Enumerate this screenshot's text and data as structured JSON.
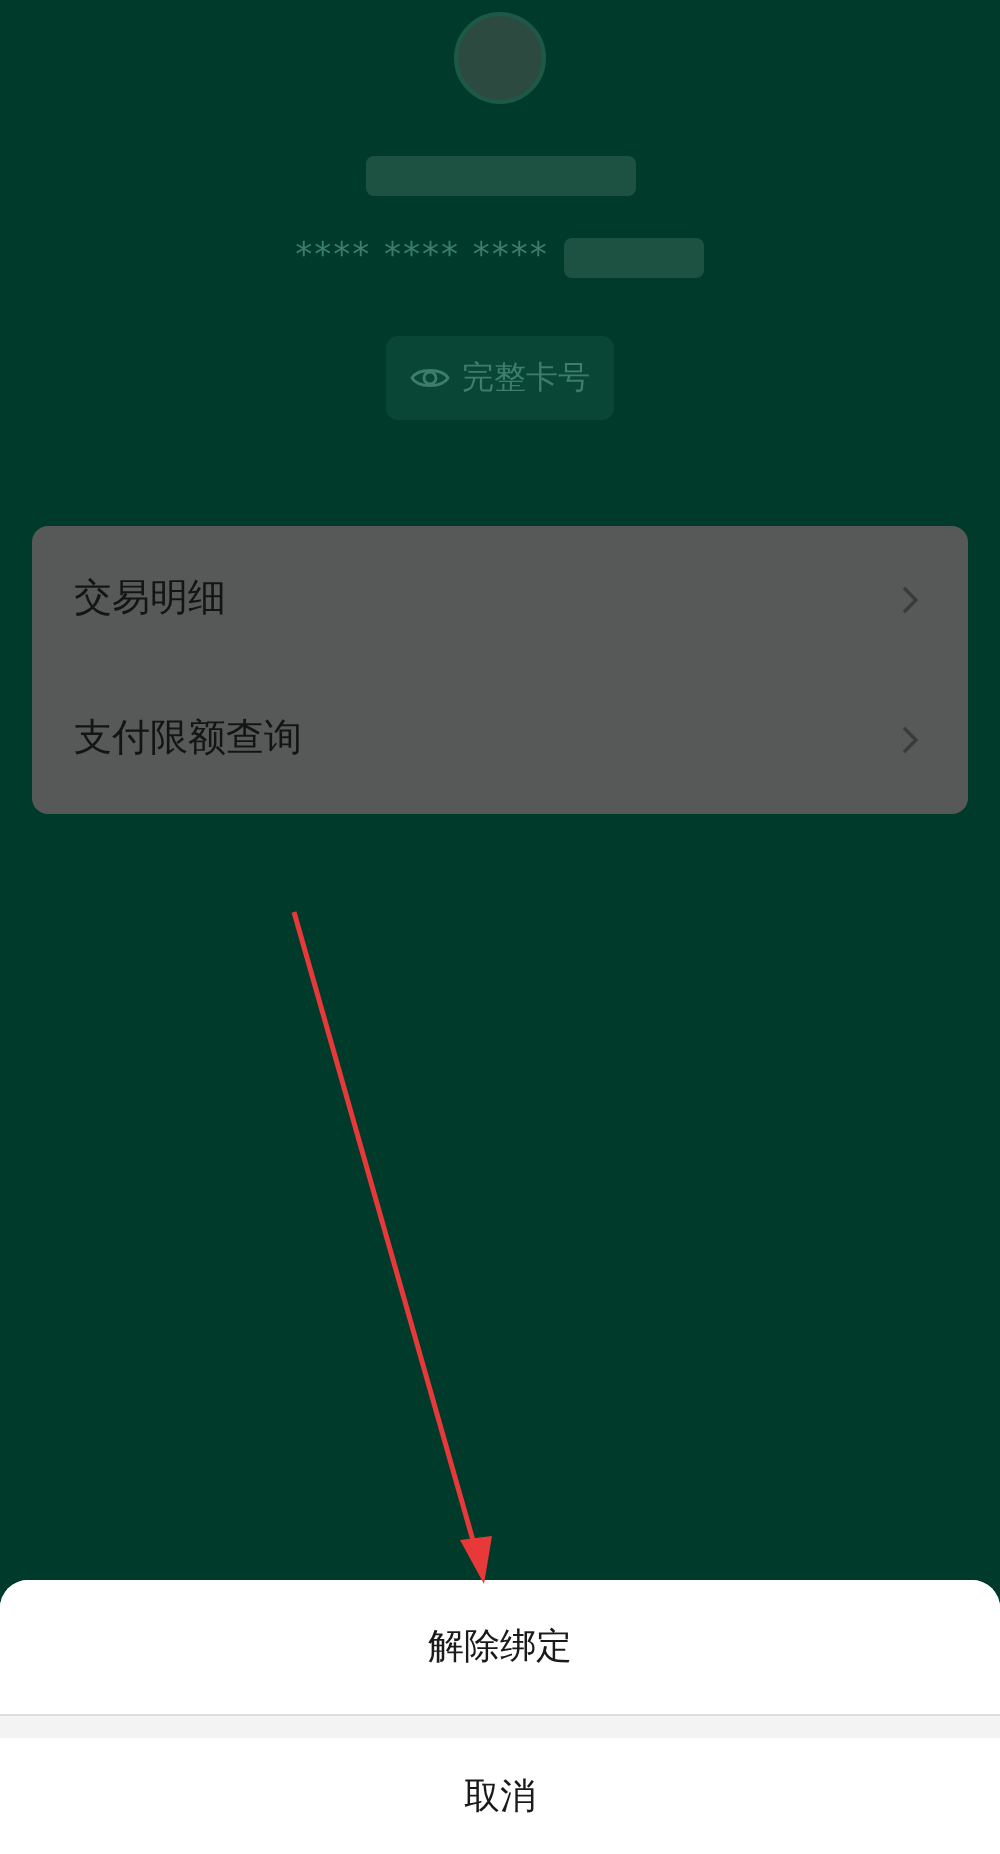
{
  "card": {
    "masked_number": "**** **** ****",
    "full_number_button": "完整卡号"
  },
  "menu": [
    {
      "label": "交易明细"
    },
    {
      "label": "支付限额查询"
    }
  ],
  "action_sheet": {
    "actions": [
      {
        "label": "解除绑定",
        "kind": "action"
      },
      {
        "label": "取消",
        "kind": "cancel"
      }
    ]
  }
}
